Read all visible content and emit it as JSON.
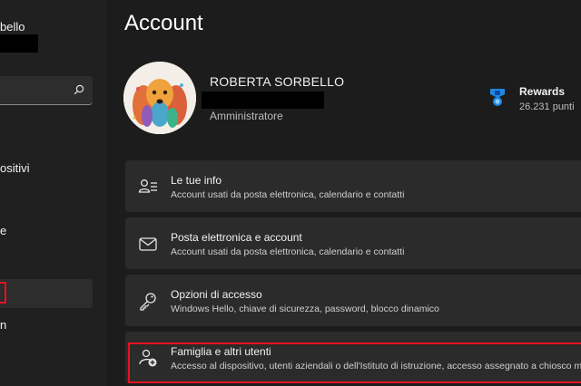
{
  "sidebar": {
    "user_name_partial": "bello",
    "items": [
      {
        "label": "ositivi"
      },
      {
        "label": "e"
      },
      {
        "label": "n"
      }
    ]
  },
  "header": {
    "title": "Account"
  },
  "profile": {
    "name": "ROBERTA SORBELLO",
    "role": "Amministratore"
  },
  "rewards": {
    "title": "Rewards",
    "points": "26.231 punti",
    "icon": "rewards-medal-icon"
  },
  "cards": [
    {
      "title": "Le tue info",
      "desc": "Account usati da posta elettronica, calendario e contatti",
      "icon": "person-info-icon"
    },
    {
      "title": "Posta elettronica e account",
      "desc": "Account usati da posta elettronica, calendario e contatti",
      "icon": "mail-icon"
    },
    {
      "title": "Opzioni di accesso",
      "desc": "Windows Hello, chiave di sicurezza, password, blocco dinamico",
      "icon": "key-icon"
    },
    {
      "title": "Famiglia e altri utenti",
      "desc": "Accesso al dispositivo, utenti aziendali o dell'Istituto di istruzione, accesso assegnato a chiosco m",
      "icon": "person-add-icon"
    }
  ],
  "colors": {
    "background": "#202020",
    "card": "#2b2b2b",
    "highlight_red": "#e81123",
    "accent": "#1e88e5"
  }
}
